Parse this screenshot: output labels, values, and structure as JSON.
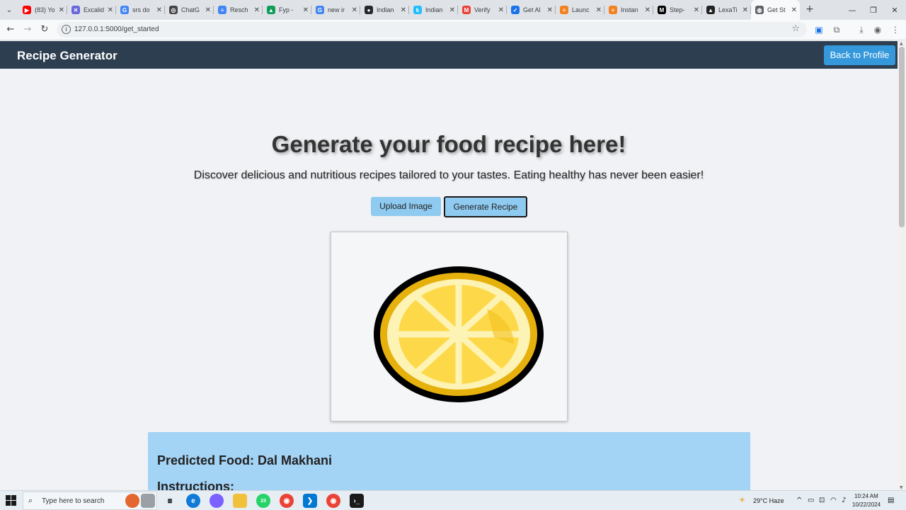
{
  "browser": {
    "tabs": [
      {
        "title": "(83) Yo",
        "fav_color": "#ff0000",
        "fav_glyph": "▶"
      },
      {
        "title": "Excalid",
        "fav_color": "#6965db",
        "fav_glyph": "✕"
      },
      {
        "title": "srs do",
        "fav_color": "#4285f4",
        "fav_glyph": "G"
      },
      {
        "title": "ChatG",
        "fav_color": "#444444",
        "fav_glyph": "◎"
      },
      {
        "title": "Resch",
        "fav_color": "#4285f4",
        "fav_glyph": "≡"
      },
      {
        "title": "Fyp -",
        "fav_color": "#0f9d58",
        "fav_glyph": "▲"
      },
      {
        "title": "new ir",
        "fav_color": "#4285f4",
        "fav_glyph": "G"
      },
      {
        "title": "Indian",
        "fav_color": "#24292f",
        "fav_glyph": "●"
      },
      {
        "title": "Indian",
        "fav_color": "#20beff",
        "fav_glyph": "k"
      },
      {
        "title": "Verify",
        "fav_color": "#ea4335",
        "fav_glyph": "M"
      },
      {
        "title": "Get Al",
        "fav_color": "#1a73e8",
        "fav_glyph": "✓"
      },
      {
        "title": "Launc",
        "fav_color": "#f48120",
        "fav_glyph": "≡"
      },
      {
        "title": "Instan",
        "fav_color": "#f48120",
        "fav_glyph": "≡"
      },
      {
        "title": "Step-",
        "fav_color": "#000000",
        "fav_glyph": "M"
      },
      {
        "title": "LexaTi",
        "fav_color": "#222222",
        "fav_glyph": "▲"
      },
      {
        "title": "Get St",
        "fav_color": "#5f6368",
        "fav_glyph": "◍",
        "active": true
      }
    ],
    "url": "127.0.0.1:5000/get_started"
  },
  "site": {
    "title": "Recipe Generator",
    "back_button": "Back to Profile"
  },
  "hero": {
    "title": "Generate your food recipe here!",
    "subtitle": "Discover delicious and nutritious recipes tailored to your tastes. Eating healthy has never been easier!"
  },
  "actions": {
    "upload_label": "Upload Image",
    "generate_label": "Generate Recipe"
  },
  "result": {
    "predicted": "Predicted Food: Dal Makhani",
    "instructions": "Instructions:"
  },
  "taskbar": {
    "search_placeholder": "Type here to search",
    "whatsapp_badge": "23",
    "weather": "29°C  Haze",
    "time": "10:24 AM",
    "date": "10/22/2024"
  },
  "colors": {
    "header_bg": "#2c3e50",
    "accent": "#3498db",
    "button_bg": "#8fcaf0",
    "result_bg": "#a3d3f5"
  }
}
